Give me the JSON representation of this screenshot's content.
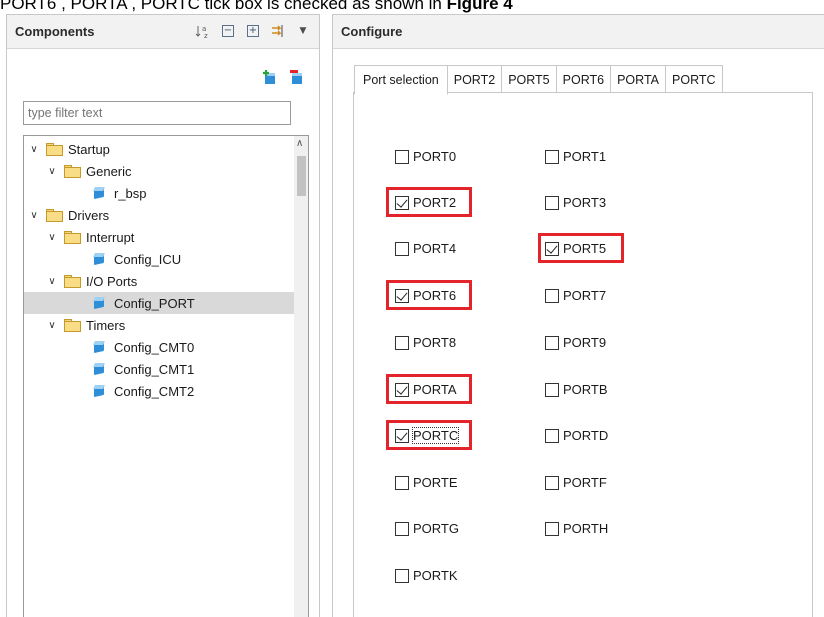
{
  "caption": {
    "text": "PORT6 , PORTA , PORTC tick box is checked as shown in ",
    "bold": "Figure 4"
  },
  "components": {
    "title": "Components",
    "filter_placeholder": "type filter text",
    "tree": [
      {
        "label": "Startup",
        "kind": "folder"
      },
      {
        "label": "Generic",
        "kind": "folder"
      },
      {
        "label": "r_bsp",
        "kind": "component"
      },
      {
        "label": "Drivers",
        "kind": "folder"
      },
      {
        "label": "Interrupt",
        "kind": "folder"
      },
      {
        "label": "Config_ICU",
        "kind": "component"
      },
      {
        "label": "I/O Ports",
        "kind": "folder"
      },
      {
        "label": "Config_PORT",
        "kind": "component",
        "selected": true
      },
      {
        "label": "Timers",
        "kind": "folder"
      },
      {
        "label": "Config_CMT0",
        "kind": "component"
      },
      {
        "label": "Config_CMT1",
        "kind": "component"
      },
      {
        "label": "Config_CMT2",
        "kind": "component"
      }
    ]
  },
  "configure": {
    "title": "Configure",
    "tabs": [
      "Port selection",
      "PORT2",
      "PORT5",
      "PORT6",
      "PORTA",
      "PORTC"
    ],
    "active_tab": "Port selection",
    "ports": [
      {
        "label": "PORT0",
        "checked": false
      },
      {
        "label": "PORT1",
        "checked": false
      },
      {
        "label": "PORT2",
        "checked": true
      },
      {
        "label": "PORT3",
        "checked": false
      },
      {
        "label": "PORT4",
        "checked": false
      },
      {
        "label": "PORT5",
        "checked": true
      },
      {
        "label": "PORT6",
        "checked": true
      },
      {
        "label": "PORT7",
        "checked": false
      },
      {
        "label": "PORT8",
        "checked": false
      },
      {
        "label": "PORT9",
        "checked": false
      },
      {
        "label": "PORTA",
        "checked": true
      },
      {
        "label": "PORTB",
        "checked": false
      },
      {
        "label": "PORTC",
        "checked": true
      },
      {
        "label": "PORTD",
        "checked": false
      },
      {
        "label": "PORTE",
        "checked": false
      },
      {
        "label": "PORTF",
        "checked": false
      },
      {
        "label": "PORTG",
        "checked": false
      },
      {
        "label": "PORTH",
        "checked": false
      },
      {
        "label": "PORTK",
        "checked": false
      }
    ]
  },
  "colors": {
    "highlight": "#e3242b",
    "selected_row": "#d9d9d9",
    "folder": "#f8dd86",
    "component_icon": "#2f8ed8"
  }
}
